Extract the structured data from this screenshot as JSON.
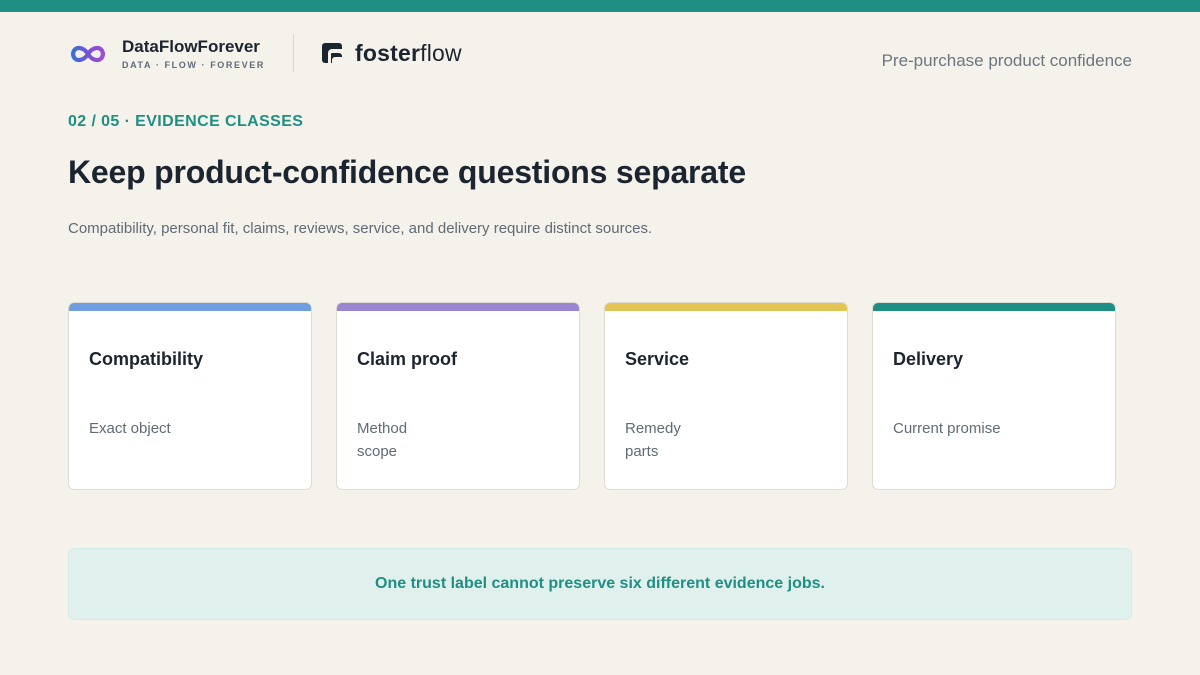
{
  "colors": {
    "top_bar": "#1f8f83",
    "background": "#f5f2eb",
    "accent_teal": "#1f8f83",
    "callout_bg": "#e0f0ec"
  },
  "header": {
    "brand_primary": {
      "name": "DataFlowForever",
      "tagline": "DATA · FLOW · FOREVER",
      "icon": "infinity-logo-icon"
    },
    "brand_secondary": {
      "name_strong": "foster",
      "name_light": "flow",
      "icon": "fosterflow-logo-icon"
    },
    "context_label": "Pre-purchase product confidence"
  },
  "slide": {
    "kicker": "02 / 05 · EVIDENCE CLASSES",
    "title": "Keep product-confidence questions separate",
    "subtitle": "Compatibility, personal fit, claims, reviews, service, and delivery require distinct sources."
  },
  "cards": [
    {
      "title": "Compatibility",
      "lines": [
        "Exact object"
      ],
      "accent": "#6f9fe0"
    },
    {
      "title": "Claim proof",
      "lines": [
        "Method",
        "scope"
      ],
      "accent": "#9a85d0"
    },
    {
      "title": "Service",
      "lines": [
        "Remedy",
        "parts"
      ],
      "accent": "#e3c556"
    },
    {
      "title": "Delivery",
      "lines": [
        "Current promise"
      ],
      "accent": "#1f8f83"
    }
  ],
  "callout": {
    "text": "One trust label cannot preserve six different evidence jobs."
  }
}
